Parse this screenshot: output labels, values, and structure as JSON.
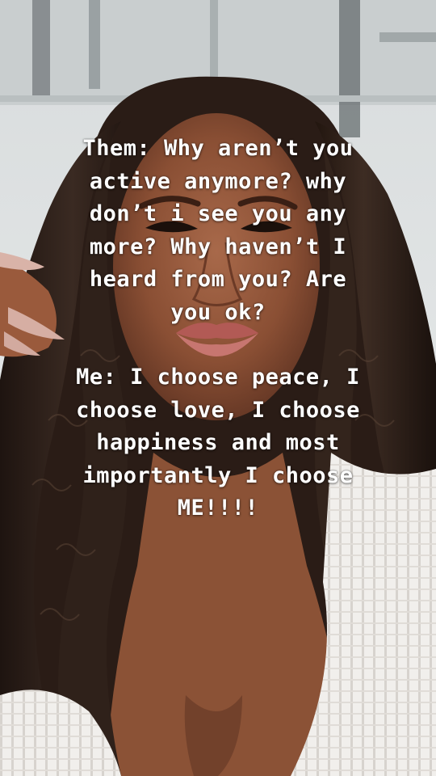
{
  "story": {
    "caption_them_lines": [
      "Them: Why aren’t you",
      "active anymore? why",
      "don’t i see you any",
      "more? Why haven’t I",
      "heard from you? Are",
      "you ok?"
    ],
    "caption_me_lines": [
      "Me: I choose peace, I",
      "choose love, I choose",
      "happiness and most",
      "importantly I choose",
      "ME!!!!"
    ]
  }
}
